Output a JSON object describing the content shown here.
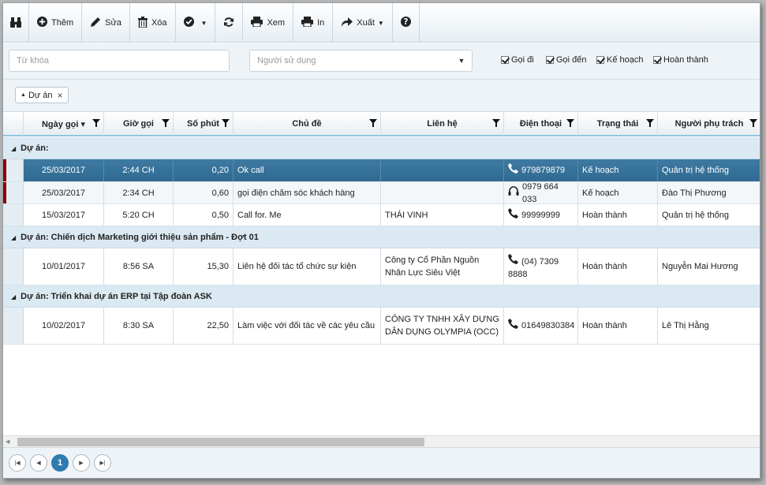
{
  "toolbar": {
    "add_label": "Thêm",
    "edit_label": "Sửa",
    "delete_label": "Xóa",
    "view_label": "Xem",
    "print_label": "In",
    "export_label": "Xuất"
  },
  "filters": {
    "keyword_placeholder": "Từ khóa",
    "user_placeholder": "Người sử dụng",
    "checks": [
      "Gọi đi",
      "Gọi đến",
      "Kế hoạch",
      "Hoàn thành"
    ]
  },
  "group_panel": {
    "chip_label": "Dự án"
  },
  "columns": [
    "Ngày gọi ▾",
    "Giờ gọi",
    "Số phút",
    "Chủ đề",
    "Liên hệ",
    "Điện thoại",
    "Trạng thái",
    "Người phụ trách"
  ],
  "groups": [
    {
      "title": "Dự án:",
      "rows": [
        {
          "date": "25/03/2017",
          "time": "2:44 CH",
          "minutes": "0,20",
          "subject": "Ok call",
          "contact": "",
          "phone": "979879879",
          "phone_icon": "phone-icon",
          "status": "Kế hoạch",
          "owner": "Quản trị hệ thống"
        },
        {
          "date": "25/03/2017",
          "time": "2:34 CH",
          "minutes": "0,60",
          "subject": "gọi điện chăm sóc khách hàng",
          "contact": "",
          "phone": "0979 664 033",
          "phone_icon": "headset-icon",
          "status": "Kế hoạch",
          "owner": "Đào Thị Phương"
        },
        {
          "date": "15/03/2017",
          "time": "5:20 CH",
          "minutes": "0,50",
          "subject": "Call for. Me",
          "contact": "THÁI VINH",
          "phone": "99999999",
          "phone_icon": "phone-icon",
          "status": "Hoàn thành",
          "owner": "Quản trị hệ thống"
        }
      ]
    },
    {
      "title": "Dự án: Chiến dịch Marketing giới thiệu sản phẩm - Đợt 01",
      "rows": [
        {
          "date": "10/01/2017",
          "time": "8:56 SA",
          "minutes": "15,30",
          "subject": "Liên hệ đối tác tổ chức sự kiện",
          "contact": "Công ty Cổ Phần Nguồn Nhân Lực Siêu Việt",
          "phone": "(04) 7309 8888",
          "phone_icon": "phone-icon",
          "status": "Hoàn thành",
          "owner": "Nguyễn Mai Hương"
        }
      ]
    },
    {
      "title": "Dự án: Triển khai dự án ERP tại Tập đoàn ASK",
      "rows": [
        {
          "date": "10/02/2017",
          "time": "8:30 SA",
          "minutes": "22,50",
          "subject": "Làm việc với đối tác về các yêu cầu",
          "contact": "CÔNG TY TNHH XÂY DỰNG DÂN DỤNG OLYMPIA (OCC)",
          "phone": "01649830384",
          "phone_icon": "phone-icon",
          "status": "Hoàn thành",
          "owner": "Lê Thị Hằng"
        }
      ]
    }
  ],
  "pager": {
    "current_page": "1"
  }
}
